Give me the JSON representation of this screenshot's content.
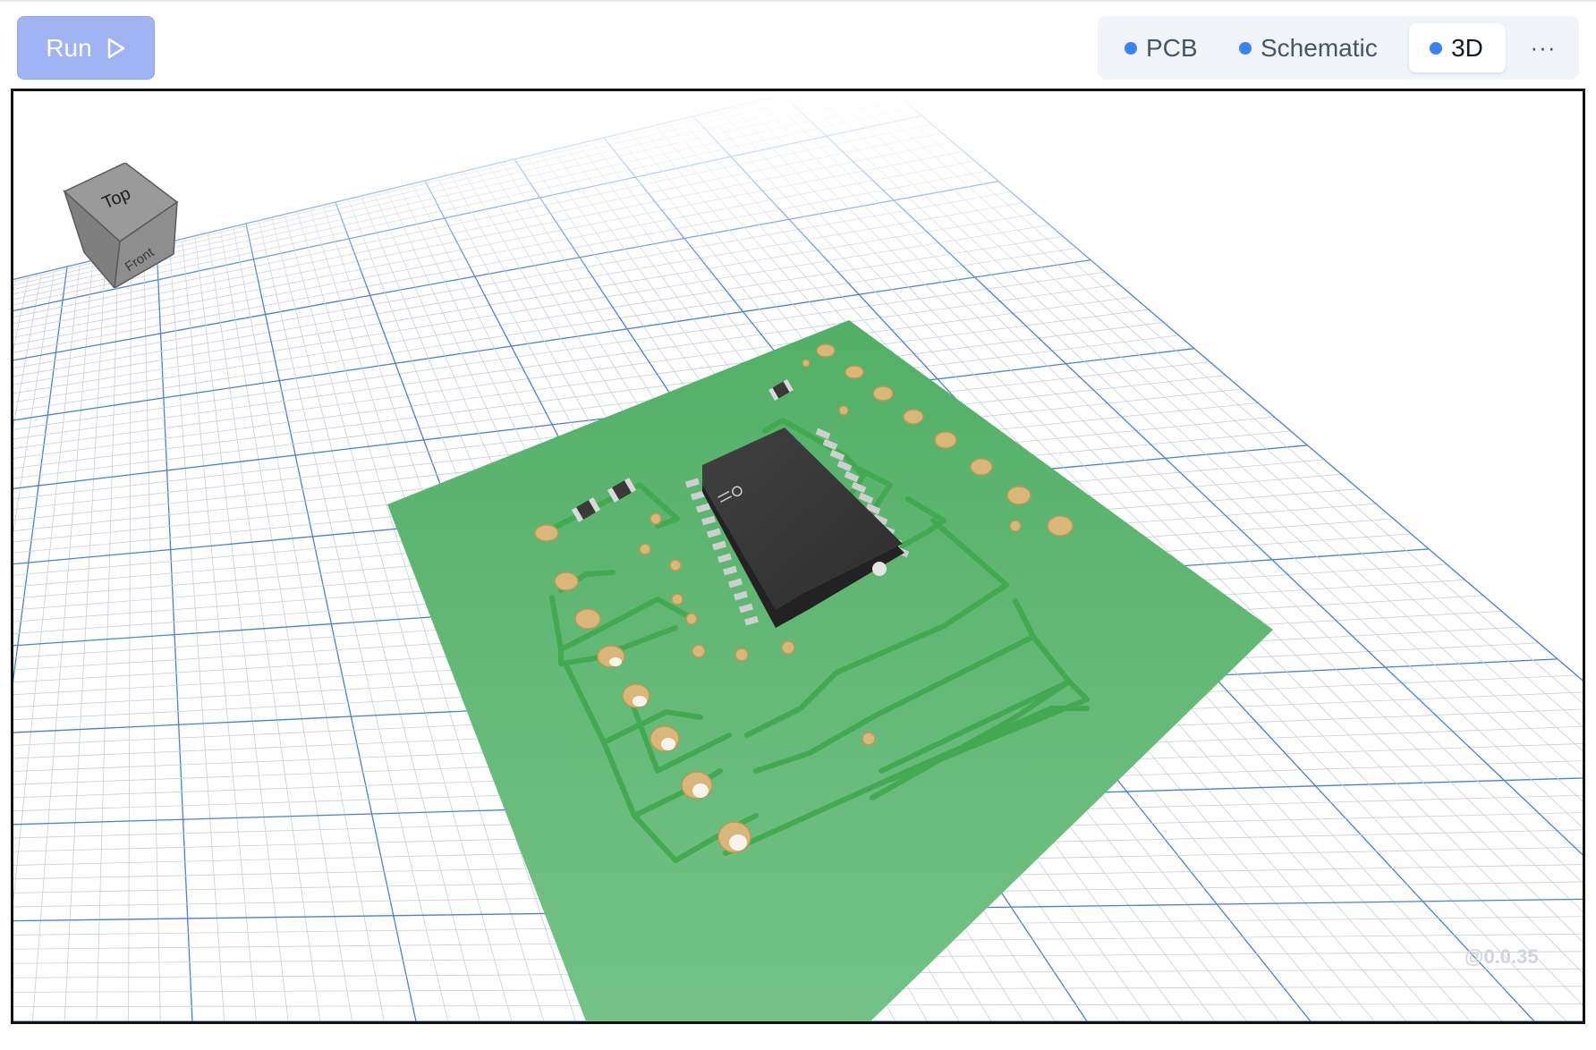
{
  "toolbar": {
    "run_label": "Run",
    "tabs": [
      {
        "label": "PCB",
        "active": false
      },
      {
        "label": "Schematic",
        "active": false
      },
      {
        "label": "3D",
        "active": true
      }
    ],
    "more_label": "···"
  },
  "viewport": {
    "view_cube": {
      "top_label": "Top",
      "front_label": "Front"
    },
    "version": "@0.0.35"
  },
  "colors": {
    "board": "#5cb870",
    "trace": "#3fa84e",
    "chip": "#3a3a3a",
    "pad": "#d9b77a",
    "grid_major": "#4a7fd4",
    "grid_minor": "#c5cad6",
    "tab_dot": "#3b82f6",
    "run_button": "#a0b4f3"
  },
  "icons": [
    "play-icon",
    "more-icon",
    "view-cube-icon"
  ]
}
